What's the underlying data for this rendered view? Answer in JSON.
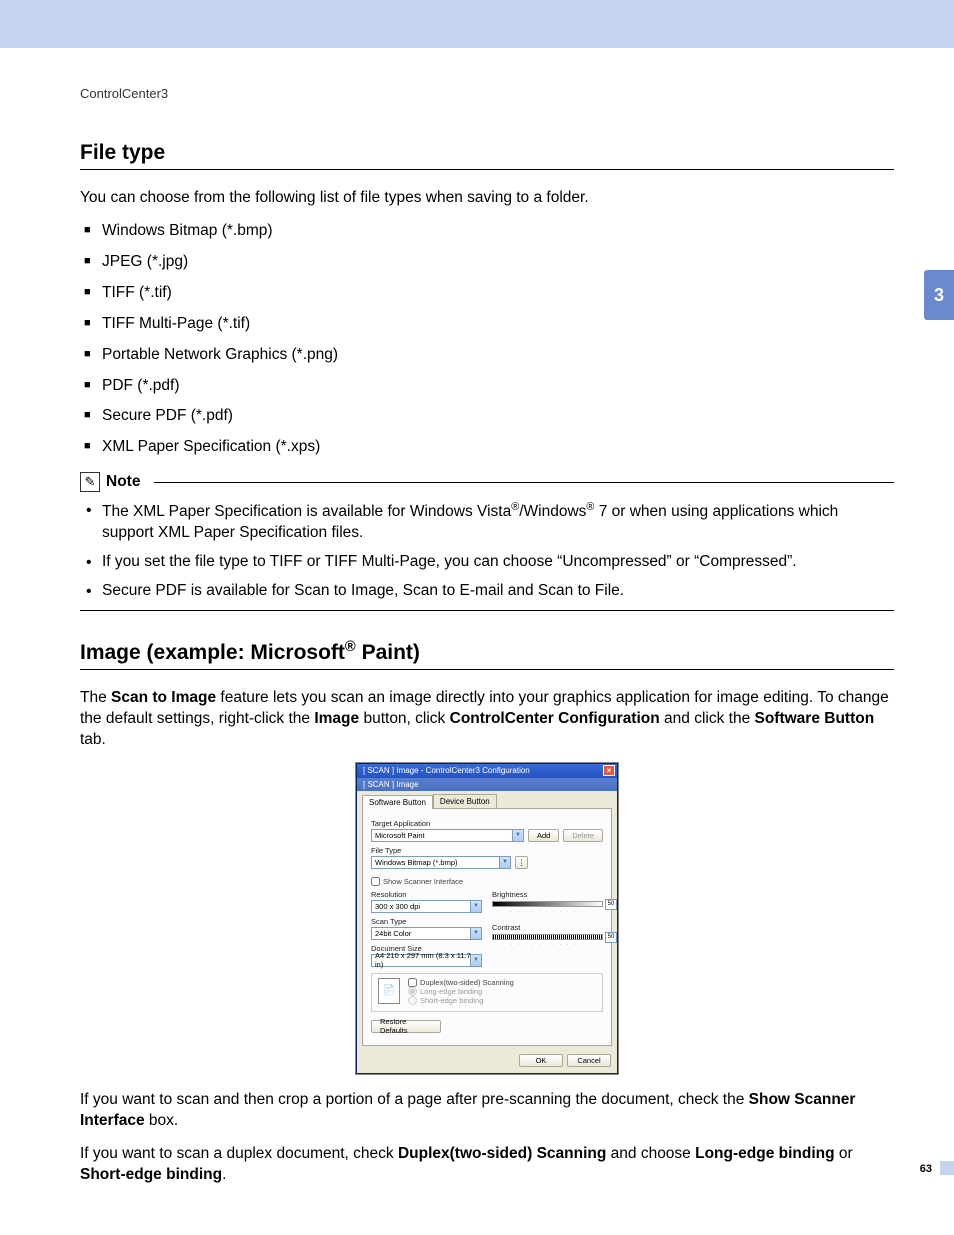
{
  "breadcrumb": "ControlCenter3",
  "side_tab": "3",
  "page_number": "63",
  "sec1": {
    "title": "File type",
    "intro": "You can choose from the following list of file types when saving to a folder.",
    "items": [
      "Windows Bitmap (*.bmp)",
      "JPEG (*.jpg)",
      "TIFF (*.tif)",
      "TIFF Multi-Page (*.tif)",
      "Portable Network Graphics (*.png)",
      "PDF (*.pdf)",
      "Secure PDF (*.pdf)",
      "XML Paper Specification (*.xps)"
    ]
  },
  "note": {
    "label": "Note",
    "b1a": "The XML Paper Specification is available for Windows Vista",
    "b1b": "/Windows",
    "b1c": " 7 or when using applications which support XML Paper Specification files.",
    "b2": "If you set the file type to TIFF or TIFF Multi-Page, you can choose “Uncompressed” or “Compressed”.",
    "b3": "Secure PDF is available for Scan to Image, Scan to E-mail and Scan to File."
  },
  "sec2": {
    "title_a": "Image (example: Microsoft",
    "title_b": " Paint)",
    "p1_a": "The ",
    "p1_b": "Scan to Image",
    "p1_c": " feature lets you scan an image directly into your graphics application for image editing. To change the default settings, right-click the ",
    "p1_d": "Image",
    "p1_e": " button, click ",
    "p1_f": "ControlCenter Configuration",
    "p1_g": " and click the ",
    "p1_h": "Software Button",
    "p1_i": " tab.",
    "p2_a": "If you want to scan and then crop a portion of a page after pre-scanning the document, check the ",
    "p2_b": "Show Scanner Interface",
    "p2_c": " box.",
    "p3_a": "If you want to scan a duplex document, check ",
    "p3_b": "Duplex(two-sided) Scanning",
    "p3_c": " and choose ",
    "p3_d": "Long-edge binding",
    "p3_e": " or ",
    "p3_f": "Short-edge binding",
    "p3_g": "."
  },
  "dialog": {
    "title": "[ SCAN ]   Image - ControlCenter3 Configuration",
    "sub": "[ SCAN ]   Image",
    "tab1": "Software Button",
    "tab2": "Device Button",
    "target_label": "Target Application",
    "target_value": "Microsoft Paint",
    "add": "Add",
    "delete": "Delete",
    "filetype_label": "File Type",
    "filetype_value": "Windows Bitmap (*.bmp)",
    "show_scanner": "Show Scanner Interface",
    "resolution_label": "Resolution",
    "resolution_value": "300 x 300 dpi",
    "scantype_label": "Scan Type",
    "scantype_value": "24bit Color",
    "docsize_label": "Document Size",
    "docsize_value": "A4 210 x 297 mm (8.3 x 11.7 in)",
    "brightness_label": "Brightness",
    "brightness_val": "50",
    "contrast_label": "Contrast",
    "contrast_val": "50",
    "duplex_check": "Duplex(two-sided) Scanning",
    "long_edge": "Long-edge binding",
    "short_edge": "Short-edge binding",
    "restore": "Restore Defaults",
    "ok": "OK",
    "cancel": "Cancel"
  }
}
